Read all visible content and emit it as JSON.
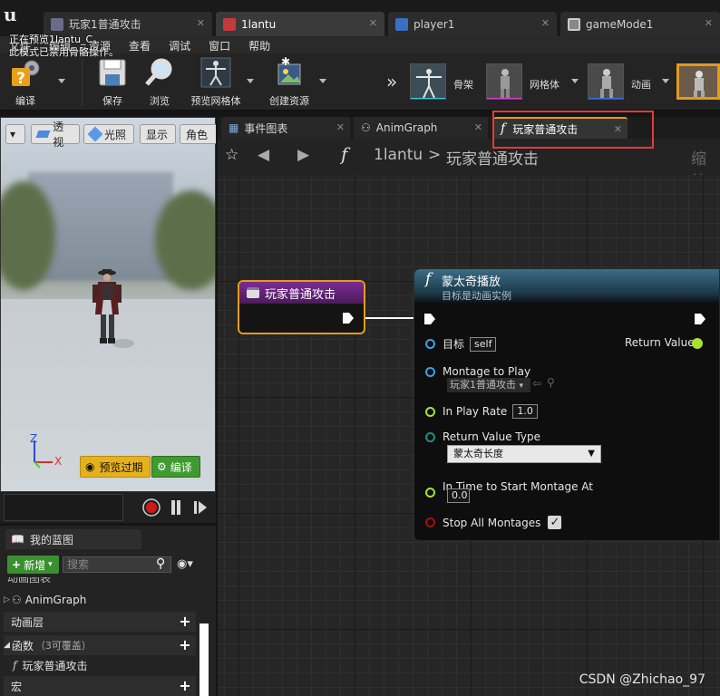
{
  "app": {
    "doc_tabs": [
      {
        "label": "玩家1普通攻击"
      },
      {
        "label": "1lantu"
      },
      {
        "label": "player1"
      },
      {
        "label": "gameMode1"
      }
    ]
  },
  "menu": [
    "文件",
    "编辑",
    "资源",
    "查看",
    "调试",
    "窗口",
    "帮助"
  ],
  "toolbar": {
    "compile": "编译",
    "save": "保存",
    "browse": "浏览",
    "preview_mesh": "预览网格体",
    "create_asset": "创建资源",
    "modes": {
      "skeleton": "骨架",
      "mesh": "网格体",
      "animation": "动画"
    }
  },
  "viewport": {
    "buttons": {
      "perspective": "透视",
      "lit": "光照",
      "show": "显示",
      "character": "角色"
    },
    "info_line1": "正在预览1lantu_C。",
    "info_line2": "此模式已禁用骨骼操作。",
    "preview_expired": "预览过期",
    "compile": "编译",
    "axis_x": "X",
    "axis_z": "Z"
  },
  "my_blueprint": {
    "tab": "我的蓝图",
    "new_button": "新增",
    "search_placeholder": "搜索",
    "partial_header": "动画图表",
    "anim_graph": "AnimGraph",
    "anim_layers": "动画层",
    "functions": "函数",
    "functions_count": "（3可覆盖）",
    "function_item": "玩家普通攻击",
    "macros": "宏"
  },
  "graph_tabs": [
    {
      "label": "事件图表"
    },
    {
      "label": "AnimGraph"
    },
    {
      "label": "玩家普通攻击"
    }
  ],
  "breadcrumb": {
    "root": "1lantu",
    "sep": ">",
    "current": "玩家普通攻击",
    "zoom": "缩放"
  },
  "entry_node": {
    "title": "玩家普通攻击"
  },
  "function_node": {
    "title": "蒙太奇播放",
    "subtitle": "目标是动画实例",
    "pins": {
      "target_label": "目标",
      "target_value": "self",
      "montage_label": "Montage to Play",
      "montage_value": "玩家1普通攻击",
      "play_rate_label": "In Play Rate",
      "play_rate_value": "1.0",
      "return_type_label": "Return Value Type",
      "return_type_value": "蒙太奇长度",
      "start_time_label": "In Time to Start Montage At",
      "start_time_value": "0.0",
      "stop_all_label": "Stop All Montages",
      "return_value_label": "Return Value"
    },
    "stop_all_checked": true
  },
  "watermark": "CSDN @Zhichao_97",
  "colors": {
    "accent_orange": "#e39b1c",
    "highlight_red": "#e53a3a",
    "exec_white": "#ffffff",
    "pin_blue": "#3aa0e6",
    "pin_green": "#a6e32c",
    "pin_teal": "#1f8f7f",
    "pin_red": "#a01010",
    "new_button_green": "#3b8f2f"
  }
}
